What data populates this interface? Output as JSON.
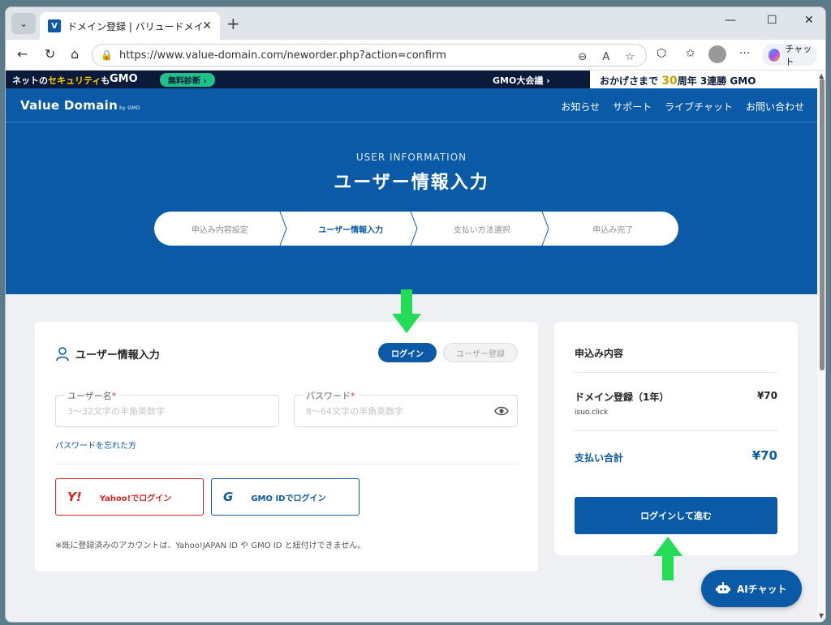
{
  "browser": {
    "tab_title": "ドメイン登録 | バリュードメイン",
    "favicon_letter": "V",
    "url": "https://www.value-domain.com/neworder.php?action=confirm",
    "copilot_label": "チャット"
  },
  "banner": {
    "left_text_a": "ネットの",
    "left_text_b": "セキュリティ",
    "left_text_c": "も",
    "gmo": "GMO",
    "pill": "無料診断 ›",
    "middle": "GMO大会議 ›",
    "right_a": "おかげさまで",
    "right_num": "30",
    "right_b": "周年 3連勝",
    "right_gmo": "GMO"
  },
  "header": {
    "logo": "Value Domain",
    "logo_by": "by GMO",
    "nav": [
      "お知らせ",
      "サポート",
      "ライブチャット",
      "お問い合わせ"
    ]
  },
  "hero": {
    "subtitle": "USER INFORMATION",
    "title": "ユーザー情報入力",
    "steps": [
      "申込み内容設定",
      "ユーザー情報入力",
      "支払い方法選択",
      "申込み完了"
    ],
    "active_step": 1
  },
  "login_card": {
    "title": "ユーザー情報入力",
    "login_tab": "ログイン",
    "register_tab": "ユーザー登録",
    "username_label": "ユーザー名",
    "username_placeholder": "3～32文字の半角英数字",
    "password_label": "パスワード",
    "password_placeholder": "8～64文字の半角英数字",
    "required_mark": "*",
    "forgot": "パスワードを忘れた方",
    "yahoo_mark": "Y!",
    "yahoo_label": "Yahoo!でログイン",
    "gmo_mark": "G",
    "gmo_label": "GMO IDでログイン",
    "note": "※既に登録済みのアカウントは、Yahoo!JAPAN ID や GMO ID と紐付けできません。"
  },
  "summary": {
    "title": "申込み内容",
    "item": "ドメイン登録（1年）",
    "item_price": "¥70",
    "domain": "isuo.click",
    "total_label": "支払い合計",
    "total_value": "¥70",
    "button": "ログインして進む"
  },
  "ai_chat": {
    "label": "AIチャット"
  },
  "colors": {
    "brand": "#0a5aa8",
    "arrow": "#22dd55",
    "yahoo": "#dd2222"
  }
}
